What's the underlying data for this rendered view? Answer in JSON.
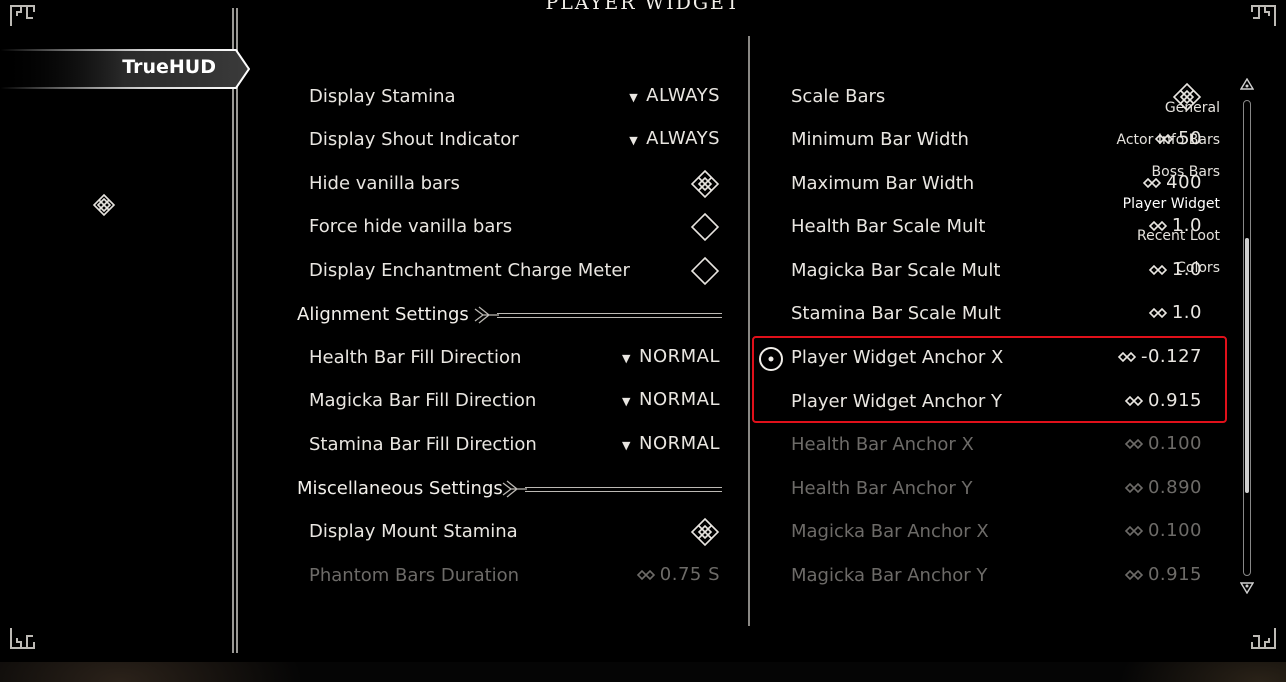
{
  "page_title": "PLAYER WIDGET",
  "sidebar": {
    "mod_name": "TrueHUD",
    "pages": [
      {
        "label": "General",
        "selected": false
      },
      {
        "label": "Actor Info Bars",
        "selected": false
      },
      {
        "label": "Boss Bars",
        "selected": false
      },
      {
        "label": "Player Widget",
        "selected": true
      },
      {
        "label": "Recent Loot",
        "selected": false
      },
      {
        "label": "Colors",
        "selected": false
      }
    ]
  },
  "left_column": {
    "display_stamina": {
      "label": "Display Stamina",
      "value": "ALWAYS"
    },
    "display_shout_indicator": {
      "label": "Display Shout Indicator",
      "value": "ALWAYS"
    },
    "hide_vanilla_bars": {
      "label": "Hide vanilla bars",
      "checked": true
    },
    "force_hide_vanilla_bars": {
      "label": "Force hide vanilla bars",
      "checked": false
    },
    "display_enchantment_charge_meter": {
      "label": "Display Enchantment Charge Meter",
      "checked": false
    },
    "alignment_header": "Alignment Settings",
    "health_bar_fill_direction": {
      "label": "Health Bar Fill Direction",
      "value": "NORMAL"
    },
    "magicka_bar_fill_direction": {
      "label": "Magicka Bar Fill Direction",
      "value": "NORMAL"
    },
    "stamina_bar_fill_direction": {
      "label": "Stamina Bar Fill Direction",
      "value": "NORMAL"
    },
    "misc_header": "Miscellaneous Settings",
    "display_mount_stamina": {
      "label": "Display Mount Stamina",
      "checked": true
    },
    "phantom_bars_duration": {
      "label": "Phantom Bars Duration",
      "value": "0.75 S"
    }
  },
  "right_column": {
    "scale_bars": {
      "label": "Scale Bars",
      "checked": true
    },
    "minimum_bar_width": {
      "label": "Minimum Bar Width",
      "value": "50"
    },
    "maximum_bar_width": {
      "label": "Maximum Bar Width",
      "value": "400"
    },
    "health_bar_scale_mult": {
      "label": "Health Bar Scale Mult",
      "value": "1.0"
    },
    "magicka_bar_scale_mult": {
      "label": "Magicka Bar Scale Mult",
      "value": "1.0"
    },
    "stamina_bar_scale_mult": {
      "label": "Stamina Bar Scale Mult",
      "value": "1.0"
    },
    "player_widget_anchor_x": {
      "label": "Player Widget Anchor X",
      "value": "-0.127"
    },
    "player_widget_anchor_y": {
      "label": "Player Widget Anchor Y",
      "value": "0.915"
    },
    "health_bar_anchor_x": {
      "label": "Health Bar Anchor X",
      "value": "0.100"
    },
    "health_bar_anchor_y": {
      "label": "Health Bar Anchor Y",
      "value": "0.890"
    },
    "magicka_bar_anchor_x": {
      "label": "Magicka Bar Anchor X",
      "value": "0.100"
    },
    "magicka_bar_anchor_y": {
      "label": "Magicka Bar Anchor Y",
      "value": "0.915"
    }
  },
  "colors": {
    "highlight": "#e0101a",
    "text": "#e9e6e1",
    "disabled_text": "#6d6b68",
    "background": "#000000"
  },
  "icons": {
    "dropdown": "dropdown-arrow-icon",
    "checkbox_on": "checkbox-checked-icon",
    "checkbox_off": "checkbox-unchecked-icon",
    "slider": "slider-diamond-icon",
    "selection": "cursor-ring-icon"
  }
}
